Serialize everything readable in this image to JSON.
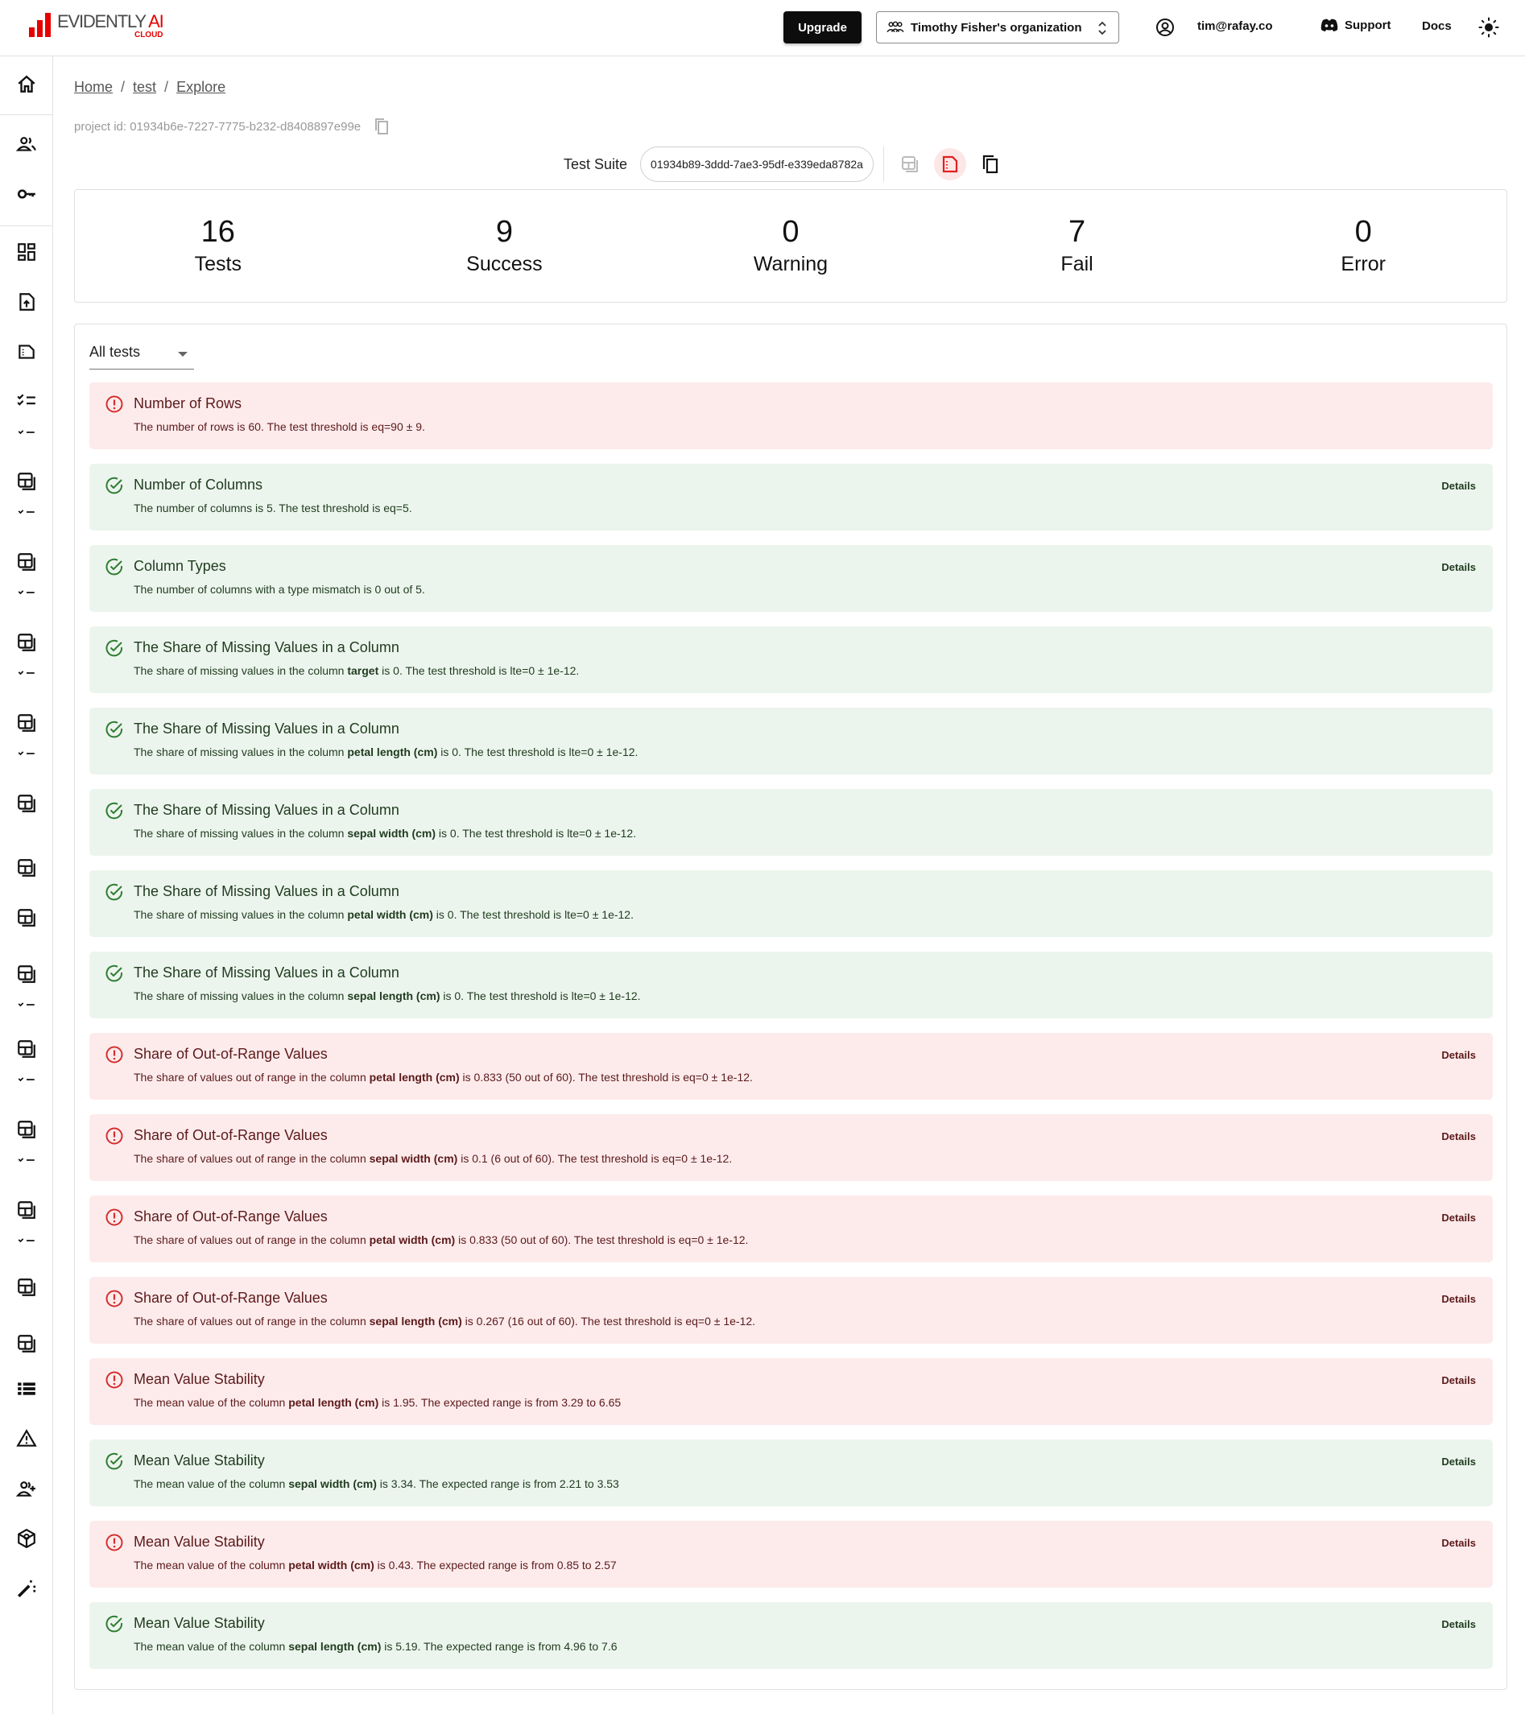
{
  "header": {
    "logo_main": "EVIDENTLY",
    "logo_ai": "AI",
    "logo_sub": "CLOUD",
    "upgrade_label": "Upgrade",
    "organization": "Timothy Fisher's organization",
    "email": "tim@rafay.co",
    "support_label": "Support",
    "docs_label": "Docs"
  },
  "sidebar": {
    "items": [
      {
        "icon": "home-icon"
      },
      {
        "icon": "users-icon"
      },
      {
        "icon": "key-icon"
      },
      {
        "icon": "dashboard-icon"
      },
      {
        "icon": "file-upload-icon"
      },
      {
        "icon": "snapshot-icon"
      },
      {
        "icon": "test-suite-icon"
      },
      {
        "icon": "report-icon"
      },
      {
        "icon": "report-icon"
      },
      {
        "icon": "report-icon"
      },
      {
        "icon": "report-icon"
      },
      {
        "icon": "report-icon"
      },
      {
        "icon": "report-icon"
      },
      {
        "icon": "report-icon"
      },
      {
        "icon": "report-icon"
      },
      {
        "icon": "report-icon"
      },
      {
        "icon": "report-icon"
      },
      {
        "icon": "report-icon"
      },
      {
        "icon": "report-icon"
      },
      {
        "icon": "list-icon"
      },
      {
        "icon": "warning-icon"
      },
      {
        "icon": "add-user-icon"
      },
      {
        "icon": "package-icon"
      },
      {
        "icon": "magic-wand-icon"
      }
    ]
  },
  "breadcrumb": {
    "items": [
      "Home",
      "test",
      "Explore"
    ],
    "separator": "/"
  },
  "project": {
    "id_label": "project id: 01934b6e-7227-7775-b232-d8408897e99e"
  },
  "suite": {
    "label": "Test Suite",
    "id": "01934b89-3ddd-7ae3-95df-e339eda8782a"
  },
  "summary": [
    {
      "value": "16",
      "label": "Tests"
    },
    {
      "value": "9",
      "label": "Success"
    },
    {
      "value": "0",
      "label": "Warning"
    },
    {
      "value": "7",
      "label": "Fail"
    },
    {
      "value": "0",
      "label": "Error"
    }
  ],
  "filter": {
    "selected": "All tests"
  },
  "details_label": "Details",
  "colors": {
    "fail_bg": "#fdebec",
    "success_bg": "#ecf5ed",
    "fail_icon": "#d32f2f",
    "success_icon": "#2e7d32",
    "brand_red": "#e60000"
  },
  "tests": [
    {
      "status": "fail",
      "title": "Number of Rows",
      "pre": "The number of rows is 60. The test threshold is eq=90 ± 9.",
      "bold": "",
      "post": "",
      "details": false
    },
    {
      "status": "success",
      "title": "Number of Columns",
      "pre": "The number of columns is 5. The test threshold is eq=5.",
      "bold": "",
      "post": "",
      "details": true
    },
    {
      "status": "success",
      "title": "Column Types",
      "pre": "The number of columns with a type mismatch is 0 out of 5.",
      "bold": "",
      "post": "",
      "details": true
    },
    {
      "status": "success",
      "title": "The Share of Missing Values in a Column",
      "pre": "The share of missing values in the column ",
      "bold": "target",
      "post": " is 0. The test threshold is lte=0 ± 1e-12.",
      "details": false
    },
    {
      "status": "success",
      "title": "The Share of Missing Values in a Column",
      "pre": "The share of missing values in the column ",
      "bold": "petal length (cm)",
      "post": " is 0. The test threshold is lte=0 ± 1e-12.",
      "details": false
    },
    {
      "status": "success",
      "title": "The Share of Missing Values in a Column",
      "pre": "The share of missing values in the column ",
      "bold": "sepal width (cm)",
      "post": " is 0. The test threshold is lte=0 ± 1e-12.",
      "details": false
    },
    {
      "status": "success",
      "title": "The Share of Missing Values in a Column",
      "pre": "The share of missing values in the column ",
      "bold": "petal width (cm)",
      "post": " is 0. The test threshold is lte=0 ± 1e-12.",
      "details": false
    },
    {
      "status": "success",
      "title": "The Share of Missing Values in a Column",
      "pre": "The share of missing values in the column ",
      "bold": "sepal length (cm)",
      "post": " is 0. The test threshold is lte=0 ± 1e-12.",
      "details": false
    },
    {
      "status": "fail",
      "title": "Share of Out-of-Range Values",
      "pre": "The share of values out of range in the column ",
      "bold": "petal length (cm)",
      "post": " is 0.833 (50 out of 60). The test threshold is eq=0 ± 1e-12.",
      "details": true
    },
    {
      "status": "fail",
      "title": "Share of Out-of-Range Values",
      "pre": "The share of values out of range in the column ",
      "bold": "sepal width (cm)",
      "post": " is 0.1 (6 out of 60). The test threshold is eq=0 ± 1e-12.",
      "details": true
    },
    {
      "status": "fail",
      "title": "Share of Out-of-Range Values",
      "pre": "The share of values out of range in the column ",
      "bold": "petal width (cm)",
      "post": " is 0.833 (50 out of 60). The test threshold is eq=0 ± 1e-12.",
      "details": true
    },
    {
      "status": "fail",
      "title": "Share of Out-of-Range Values",
      "pre": "The share of values out of range in the column ",
      "bold": "sepal length (cm)",
      "post": " is 0.267 (16 out of 60). The test threshold is eq=0 ± 1e-12.",
      "details": true
    },
    {
      "status": "fail",
      "title": "Mean Value Stability",
      "pre": "The mean value of the column ",
      "bold": "petal length (cm)",
      "post": " is 1.95. The expected range is from 3.29 to 6.65",
      "details": true
    },
    {
      "status": "success",
      "title": "Mean Value Stability",
      "pre": "The mean value of the column ",
      "bold": "sepal width (cm)",
      "post": " is 3.34. The expected range is from 2.21 to 3.53",
      "details": true
    },
    {
      "status": "fail",
      "title": "Mean Value Stability",
      "pre": "The mean value of the column ",
      "bold": "petal width (cm)",
      "post": " is 0.43. The expected range is from 0.85 to 2.57",
      "details": true
    },
    {
      "status": "success",
      "title": "Mean Value Stability",
      "pre": "The mean value of the column ",
      "bold": "sepal length (cm)",
      "post": " is 5.19. The expected range is from 4.96 to 7.6",
      "details": true
    }
  ]
}
